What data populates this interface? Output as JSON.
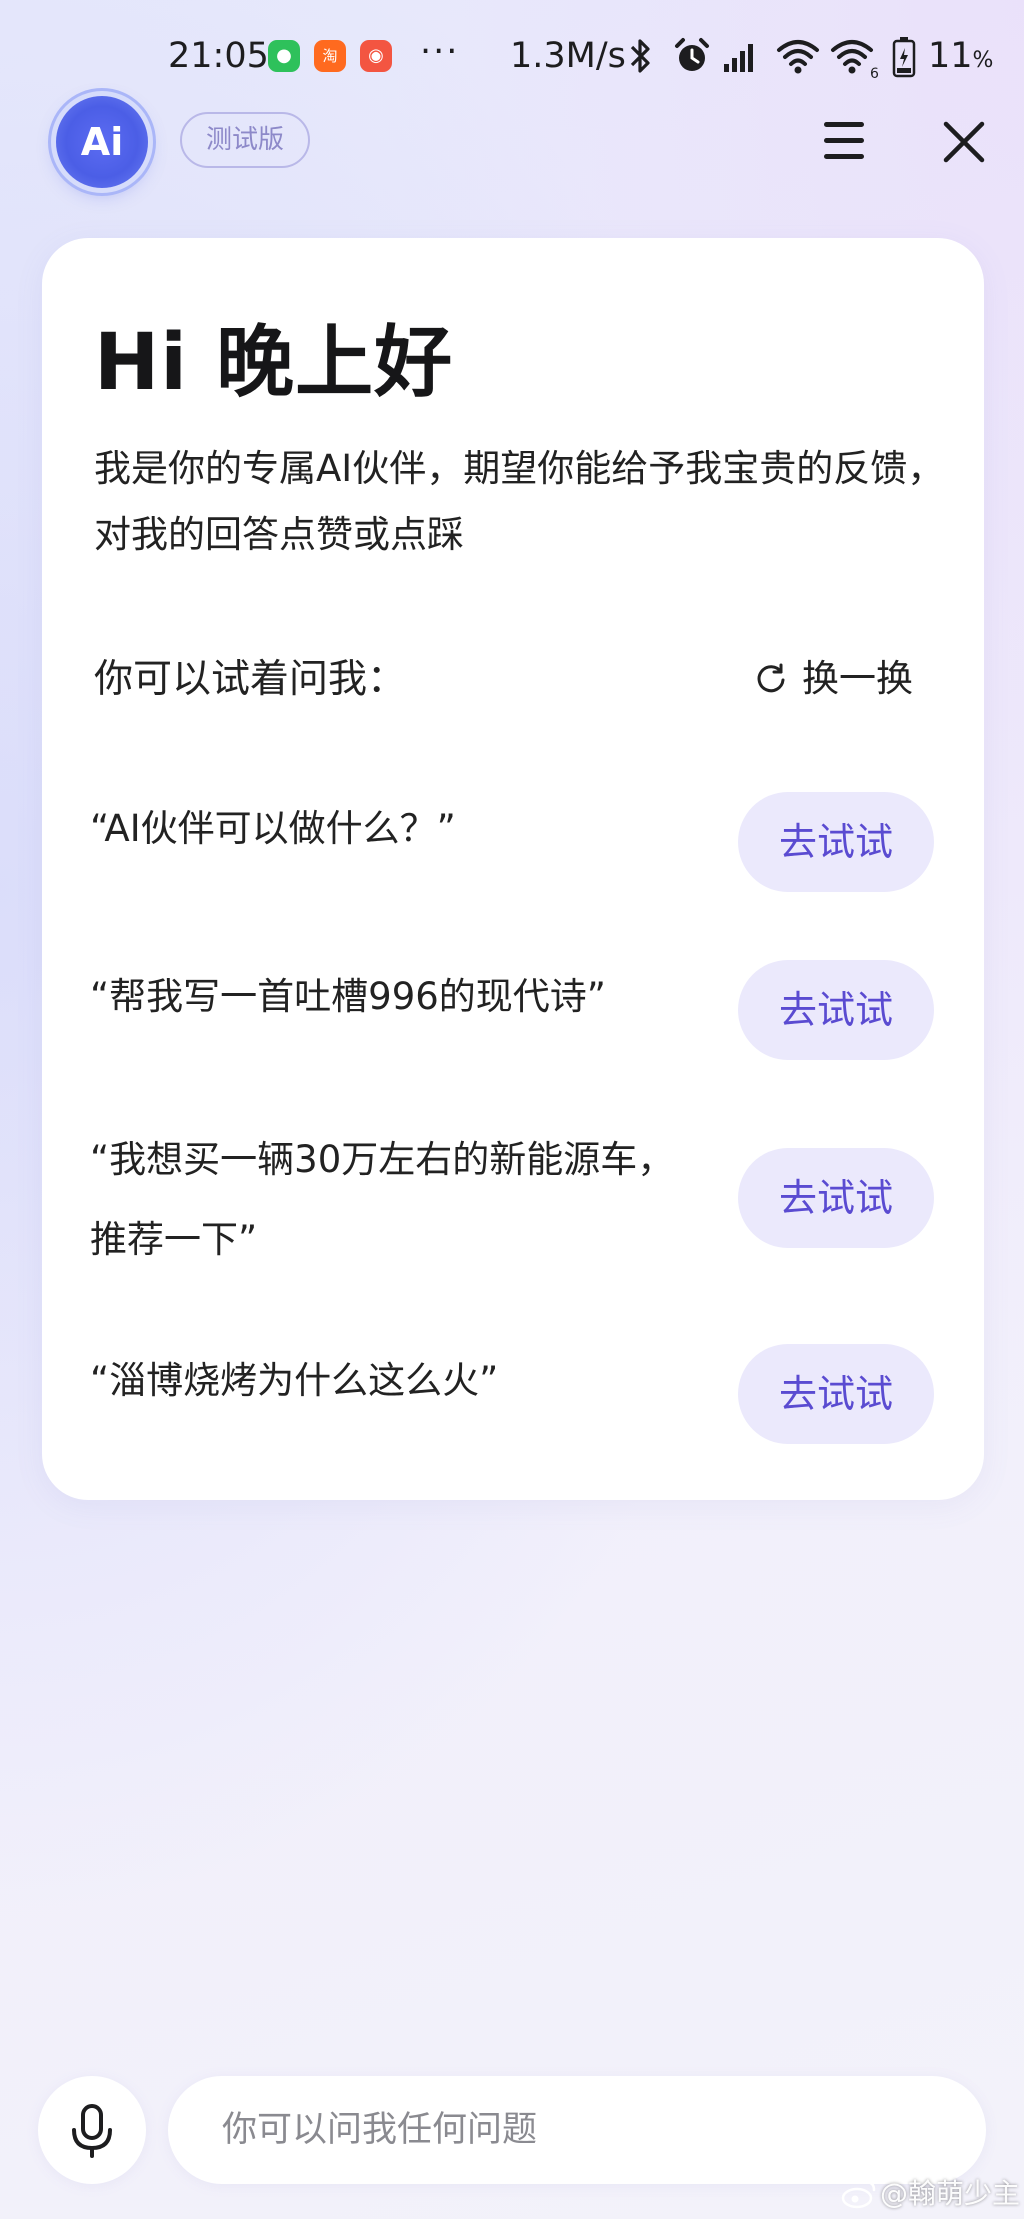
{
  "status_bar": {
    "time": "21:05",
    "notification_icons": [
      "wechat-icon",
      "taobao-icon",
      "xiaomi-icon"
    ],
    "more": "···",
    "net_speed": "1.3M/s",
    "battery_percent": "11",
    "battery_unit": "%"
  },
  "header": {
    "logo_text": "Ai",
    "badge": "测试版"
  },
  "card": {
    "greeting": "Hi 晚上好",
    "intro": "我是你的专属AI伙伴，期望你能给予我宝贵的反馈，对我的回答点赞或点踩",
    "try_label": "你可以试着问我：",
    "refresh_label": "换一换",
    "suggestions": [
      {
        "text": "“AI伙伴可以做什么？”",
        "button": "去试试"
      },
      {
        "text": "“帮我写一首吐槽996的现代诗”",
        "button": "去试试"
      },
      {
        "text": "“我想买一辆30万左右的新能源车，推荐一下”",
        "button": "去试试"
      },
      {
        "text": "“淄博烧烤为什么这么火”",
        "button": "去试试"
      }
    ]
  },
  "input": {
    "placeholder": "你可以问我任何问题",
    "value": ""
  },
  "watermark": "@翰萌少主",
  "colors": {
    "accent": "#5a4bd1",
    "button_bg": "#ebe9fc",
    "logo": "#4b5ee6"
  }
}
